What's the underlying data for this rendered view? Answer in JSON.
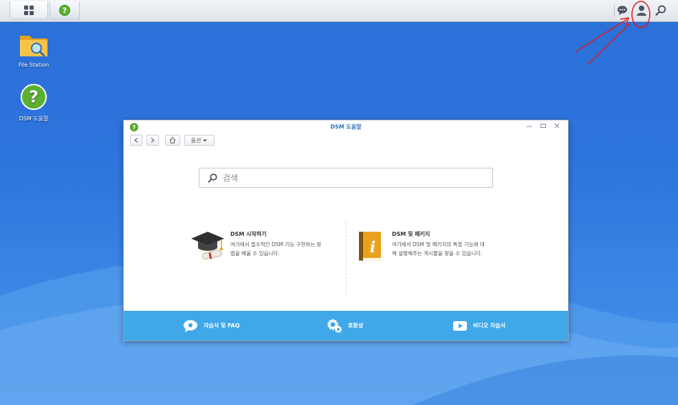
{
  "desktop": {
    "icons": [
      {
        "label": "File Station"
      },
      {
        "label": "DSM 도움말"
      }
    ]
  },
  "taskbar": {
    "main_menu_icon": "grid-icon",
    "help_app_icon": "help-circle-icon",
    "right_icons": [
      "chat-bubble-icon",
      "user-icon",
      "search-icon"
    ]
  },
  "window": {
    "title": "DSM 도움말",
    "toolbar": {
      "options_label": "옵션"
    },
    "search": {
      "placeholder": "검색"
    },
    "topics": [
      {
        "title": "DSM 시작하기",
        "desc_line1": "여기에서 필수적인 DSM 기능 구현하는 방",
        "desc_line2": "법을 배울 수 있습니다."
      },
      {
        "title": "DSM 및 패키지",
        "desc_line1": "여기에서 DSM 및 패키지의 특정 기능에 대",
        "desc_line2": "해 설명해주는 게시물을 찾을 수 있습니다."
      }
    ],
    "footer": [
      {
        "label": "자습서 및 FAQ"
      },
      {
        "label": "호환성"
      },
      {
        "label": "비디오 자습서"
      }
    ]
  },
  "colors": {
    "desktop_bg": "#2d74dc",
    "accent": "#3fa8e8",
    "title": "#2a76c6",
    "annotation": "#e01b1b"
  }
}
